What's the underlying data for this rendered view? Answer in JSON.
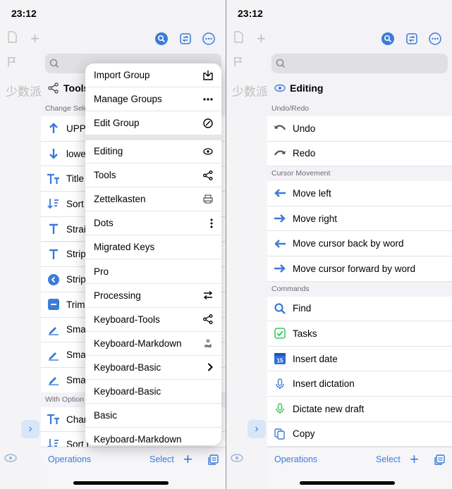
{
  "status": {
    "time": "23:12"
  },
  "left": {
    "bg_text": "少数派",
    "title": "Tools",
    "section_header": "Change Sele",
    "rows": [
      "UPPE",
      "lower",
      "Title",
      "Sort",
      "Straig",
      "Strip",
      "Strip",
      "Trim",
      "Smar",
      "Smar",
      "Smar"
    ],
    "section_header_2": "With Option",
    "rows_2": [
      "Chan",
      "Sort L"
    ],
    "bottom": {
      "operations": "Operations",
      "select": "Select"
    }
  },
  "menu": {
    "group_items": [
      "Import Group",
      "Manage Groups",
      "Edit Group"
    ],
    "items": [
      "Editing",
      "Tools",
      "Zettelkasten",
      "Dots",
      "Migrated Keys",
      "Pro",
      "Processing",
      "Keyboard-Tools",
      "Keyboard-Markdown",
      "Keyboard-Basic",
      "Keyboard-Basic",
      "Basic",
      "Keyboard-Markdown"
    ]
  },
  "right": {
    "bg_text": "少数派",
    "title": "Editing",
    "sections": [
      {
        "header": "Undo/Redo",
        "rows": [
          "Undo",
          "Redo"
        ]
      },
      {
        "header": "Cursor Movement",
        "rows": [
          "Move left",
          "Move right",
          "Move cursor back by word",
          "Move cursor forward by word"
        ]
      },
      {
        "header": "Commands",
        "rows": [
          "Find",
          "Tasks",
          "Insert date",
          "Insert dictation",
          "Dictate new draft",
          "Copy"
        ]
      }
    ],
    "bottom": {
      "operations": "Operations",
      "select": "Select"
    }
  },
  "colors": {
    "accent": "#3b7bd9",
    "green": "#34c759",
    "blue_badge": "#2f6fd8"
  }
}
